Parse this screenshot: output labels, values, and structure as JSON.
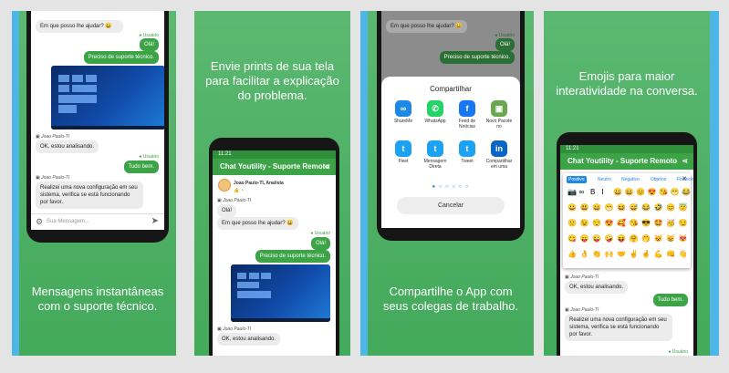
{
  "panel1": {
    "caption": "Mensagens instantâneas\ncom o suporte técnico.",
    "msg1": "Em que posso lhe ajudar? 😀",
    "user_label": "Usuário",
    "reply_ola": "Olá!",
    "reply_support": "Preciso de suporte técnico.",
    "agent_name": "Joao Paulo-TI",
    "msg_analisando": "OK, estou analisando.",
    "user_label2": "Usuário",
    "reply_tudo_bem": "Tudo bem.",
    "agent_name2": "Joao Paulo-TI",
    "msg_config": "Realizei uma nova configuração em seu sistema, verifica se está funcionando por favor.",
    "input_placeholder": "Sua Mensagem..."
  },
  "panel2": {
    "caption": "Envie prints de sua tela\npara facilitar a explicação\ndo problema.",
    "status_time": "11:21",
    "app_title": "Chat Youtility - Suporte Remoto",
    "agent_header": "Joao Paulo-TI, Analista",
    "agent_name": "Joao Paulo-TI",
    "msg_ola": "Olá!",
    "msg1": "Em que posso lhe ajudar? 😀",
    "user_label": "Usuário",
    "reply_ola": "Olá!",
    "reply_support": "Preciso de suporte técnico.",
    "agent_name2": "Joao Paulo-TI",
    "msg_analisando": "OK, estou analisando."
  },
  "panel3": {
    "caption": "Compartilhe o App com\nseus colegas de trabalho.",
    "msg1": "Em que posso lhe ajudar? 😀",
    "user_label": "Usuário",
    "reply_ola": "Olá!",
    "reply_support": "Preciso de suporte técnico.",
    "share_title": "Compartilhar",
    "share_items": [
      {
        "label": "ShareMe",
        "color": "#1e88e5",
        "glyph": "∞"
      },
      {
        "label": "WhatsApp",
        "color": "#25d366",
        "glyph": "✆"
      },
      {
        "label": "Feed de Notícias",
        "color": "#1877f2",
        "glyph": "f"
      },
      {
        "label": "Novo Pacote no",
        "color": "#6aa84f",
        "glyph": "▣"
      },
      {
        "label": "Fleet",
        "color": "#1da1f2",
        "glyph": "t"
      },
      {
        "label": "Mensagem Direta",
        "color": "#1da1f2",
        "glyph": "t"
      },
      {
        "label": "Tweet",
        "color": "#1da1f2",
        "glyph": "t"
      },
      {
        "label": "Compartilhar em uma",
        "color": "#0a66c2",
        "glyph": "in"
      }
    ],
    "cancel_label": "Cancelar"
  },
  "panel4": {
    "caption": "Emojis para maior\ninteratividade na conversa.",
    "status_time": "11:21",
    "app_title": "Chat Youtility - Suporte Remoto",
    "emoji_tabs": [
      "Positivo",
      "Neutro",
      "Negativo",
      "Objetos",
      "Financeiro"
    ],
    "close_glyph": "✕",
    "format_row": [
      "📷",
      "∞",
      "B",
      "I",
      "😀",
      "😄",
      "😊",
      "😍",
      "😘",
      "😁",
      "😂"
    ],
    "emoji_rows": [
      [
        "😀",
        "😃",
        "😄",
        "😁",
        "😆",
        "😅",
        "😂",
        "🤣",
        "😊",
        "😇"
      ],
      [
        "🙂",
        "😉",
        "😌",
        "😍",
        "🥰",
        "😘",
        "😎",
        "🤩",
        "🥳",
        "😏"
      ],
      [
        "😋",
        "😛",
        "😜",
        "🤪",
        "😝",
        "🤗",
        "🤭",
        "😺",
        "😸",
        "😻"
      ],
      [
        "👍",
        "👌",
        "👏",
        "🙌",
        "🤝",
        "✌",
        "🤞",
        "💪",
        "👊",
        "👋"
      ]
    ],
    "agent_name": "Joao Paulo-TI",
    "msg_analisando": "OK, estou analisando.",
    "reply_tudo_bem": "Tudo bem.",
    "agent_name2": "Joao Paulo-TI",
    "msg_config": "Realizei uma nova configuração em seu sistema, verifica se está funcionando por favor.",
    "user_label": "Usuário"
  }
}
